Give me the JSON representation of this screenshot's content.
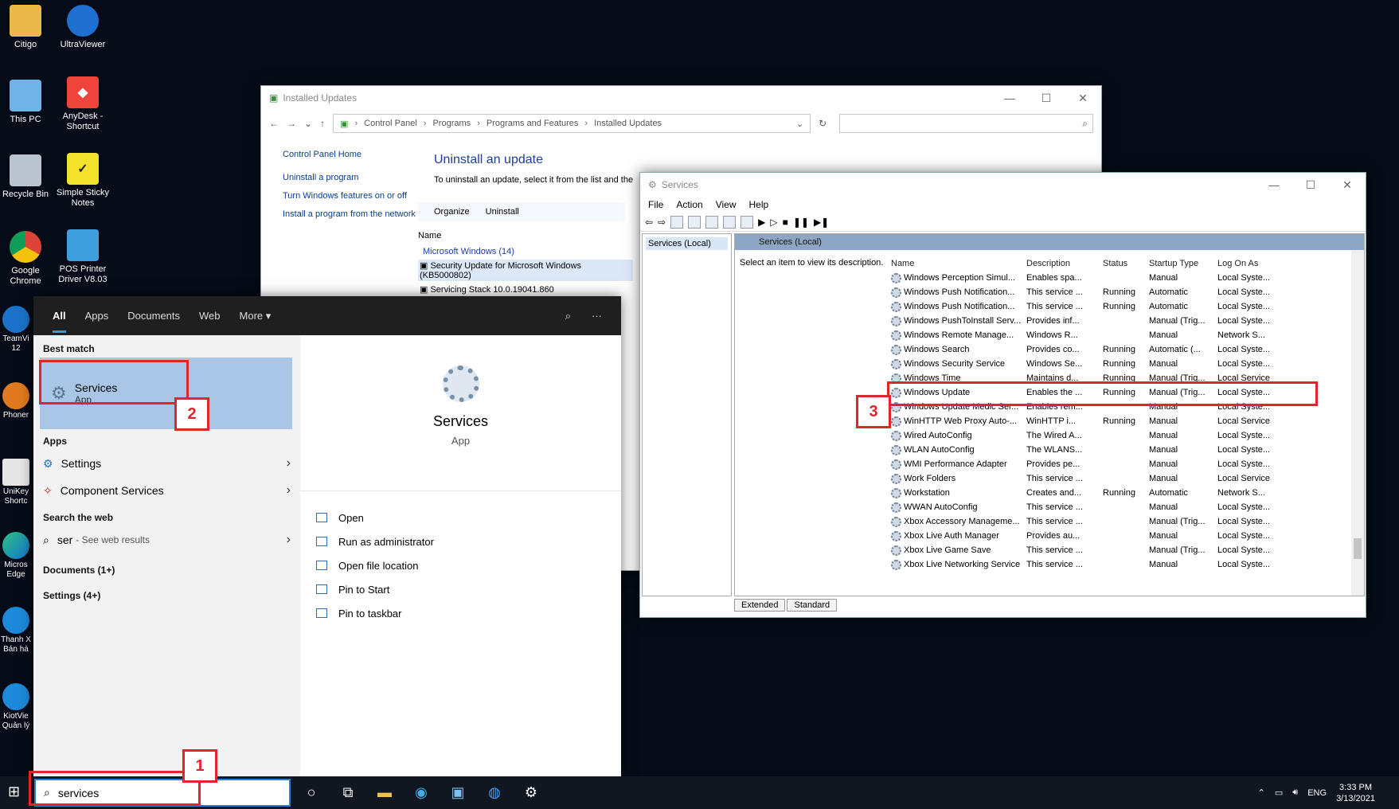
{
  "desktop": {
    "icons": [
      {
        "label": "Citigo"
      },
      {
        "label": "UltraViewer"
      },
      {
        "label": "This PC"
      },
      {
        "label": "AnyDesk - Shortcut"
      },
      {
        "label": "Recycle Bin"
      },
      {
        "label": "Simple Sticky Notes"
      },
      {
        "label": "Google Chrome"
      },
      {
        "label": "POS Printer Driver V8.03"
      }
    ],
    "strip": [
      "TeamVi 12",
      "Phoner",
      "UniKey Shortc",
      "Micros Edge",
      "Thanh X Bán hà",
      "KiotVie Quản lý"
    ]
  },
  "installed_updates": {
    "title": "Installed Updates",
    "breadcrumb": [
      "Control Panel",
      "Programs",
      "Programs and Features",
      "Installed Updates"
    ],
    "left_links": [
      "Control Panel Home",
      "Uninstall a program",
      "Turn Windows features on or off",
      "Install a program from the network"
    ],
    "heading": "Uninstall an update",
    "subtext": "To uninstall an update, select it from the list and the",
    "organize": "Organize",
    "uninstall": "Uninstall",
    "col_name": "Name",
    "group": "Microsoft Windows (14)",
    "rows": [
      "Security Update for Microsoft Windows (KB5000802)",
      "Servicing Stack 10.0.19041.860"
    ]
  },
  "services": {
    "title": "Services",
    "menu": [
      "File",
      "Action",
      "View",
      "Help"
    ],
    "tree_item": "Services (Local)",
    "pane_header": "Services (Local)",
    "desc_prompt": "Select an item to view its description.",
    "columns": [
      "Name",
      "Description",
      "Status",
      "Startup Type",
      "Log On As"
    ],
    "rows": [
      {
        "name": "Windows Perception Simul...",
        "desc": "Enables spa...",
        "status": "",
        "startup": "Manual",
        "logon": "Local Syste..."
      },
      {
        "name": "Windows Push Notification...",
        "desc": "This service ...",
        "status": "Running",
        "startup": "Automatic",
        "logon": "Local Syste..."
      },
      {
        "name": "Windows Push Notification...",
        "desc": "This service ...",
        "status": "Running",
        "startup": "Automatic",
        "logon": "Local Syste..."
      },
      {
        "name": "Windows PushToInstall Serv...",
        "desc": "Provides inf...",
        "status": "",
        "startup": "Manual (Trig...",
        "logon": "Local Syste..."
      },
      {
        "name": "Windows Remote Manage...",
        "desc": "Windows R...",
        "status": "",
        "startup": "Manual",
        "logon": "Network S..."
      },
      {
        "name": "Windows Search",
        "desc": "Provides co...",
        "status": "Running",
        "startup": "Automatic (...",
        "logon": "Local Syste..."
      },
      {
        "name": "Windows Security Service",
        "desc": "Windows Se...",
        "status": "Running",
        "startup": "Manual",
        "logon": "Local Syste..."
      },
      {
        "name": "Windows Time",
        "desc": "Maintains d...",
        "status": "Running",
        "startup": "Manual (Trig...",
        "logon": "Local Service"
      },
      {
        "name": "Windows Update",
        "desc": "Enables the ...",
        "status": "Running",
        "startup": "Manual (Trig...",
        "logon": "Local Syste..."
      },
      {
        "name": "Windows Update Medic Ser...",
        "desc": "Enables rem...",
        "status": "",
        "startup": "Manual",
        "logon": "Local Syste..."
      },
      {
        "name": "WinHTTP Web Proxy Auto-...",
        "desc": "WinHTTP i...",
        "status": "Running",
        "startup": "Manual",
        "logon": "Local Service"
      },
      {
        "name": "Wired AutoConfig",
        "desc": "The Wired A...",
        "status": "",
        "startup": "Manual",
        "logon": "Local Syste..."
      },
      {
        "name": "WLAN AutoConfig",
        "desc": "The WLANS...",
        "status": "",
        "startup": "Manual",
        "logon": "Local Syste..."
      },
      {
        "name": "WMI Performance Adapter",
        "desc": "Provides pe...",
        "status": "",
        "startup": "Manual",
        "logon": "Local Syste..."
      },
      {
        "name": "Work Folders",
        "desc": "This service ...",
        "status": "",
        "startup": "Manual",
        "logon": "Local Service"
      },
      {
        "name": "Workstation",
        "desc": "Creates and...",
        "status": "Running",
        "startup": "Automatic",
        "logon": "Network S..."
      },
      {
        "name": "WWAN AutoConfig",
        "desc": "This service ...",
        "status": "",
        "startup": "Manual",
        "logon": "Local Syste..."
      },
      {
        "name": "Xbox Accessory Manageme...",
        "desc": "This service ...",
        "status": "",
        "startup": "Manual (Trig...",
        "logon": "Local Syste..."
      },
      {
        "name": "Xbox Live Auth Manager",
        "desc": "Provides au...",
        "status": "",
        "startup": "Manual",
        "logon": "Local Syste..."
      },
      {
        "name": "Xbox Live Game Save",
        "desc": "This service ...",
        "status": "",
        "startup": "Manual (Trig...",
        "logon": "Local Syste..."
      },
      {
        "name": "Xbox Live Networking Service",
        "desc": "This service ...",
        "status": "",
        "startup": "Manual",
        "logon": "Local Syste..."
      }
    ],
    "tabs": [
      "Extended",
      "Standard"
    ]
  },
  "start_menu": {
    "tabs": [
      "All",
      "Apps",
      "Documents",
      "Web",
      "More"
    ],
    "best_match_label": "Best match",
    "best_match": {
      "name": "Services",
      "type": "App"
    },
    "apps_label": "Apps",
    "apps": [
      "Settings",
      "Component Services"
    ],
    "web_label": "Search the web",
    "web_query": "ser",
    "web_hint": "- See web results",
    "documents": "Documents (1+)",
    "settings": "Settings (4+)",
    "preview": {
      "name": "Services",
      "type": "App"
    },
    "actions": [
      "Open",
      "Run as administrator",
      "Open file location",
      "Pin to Start",
      "Pin to taskbar"
    ]
  },
  "taskbar": {
    "search_value": "services",
    "lang": "ENG",
    "time": "3:33 PM",
    "date": "3/13/2021"
  },
  "callouts": [
    "1",
    "2",
    "3"
  ],
  "colors": {
    "accent": "#2b7fd0",
    "callout": "#e0252c"
  }
}
